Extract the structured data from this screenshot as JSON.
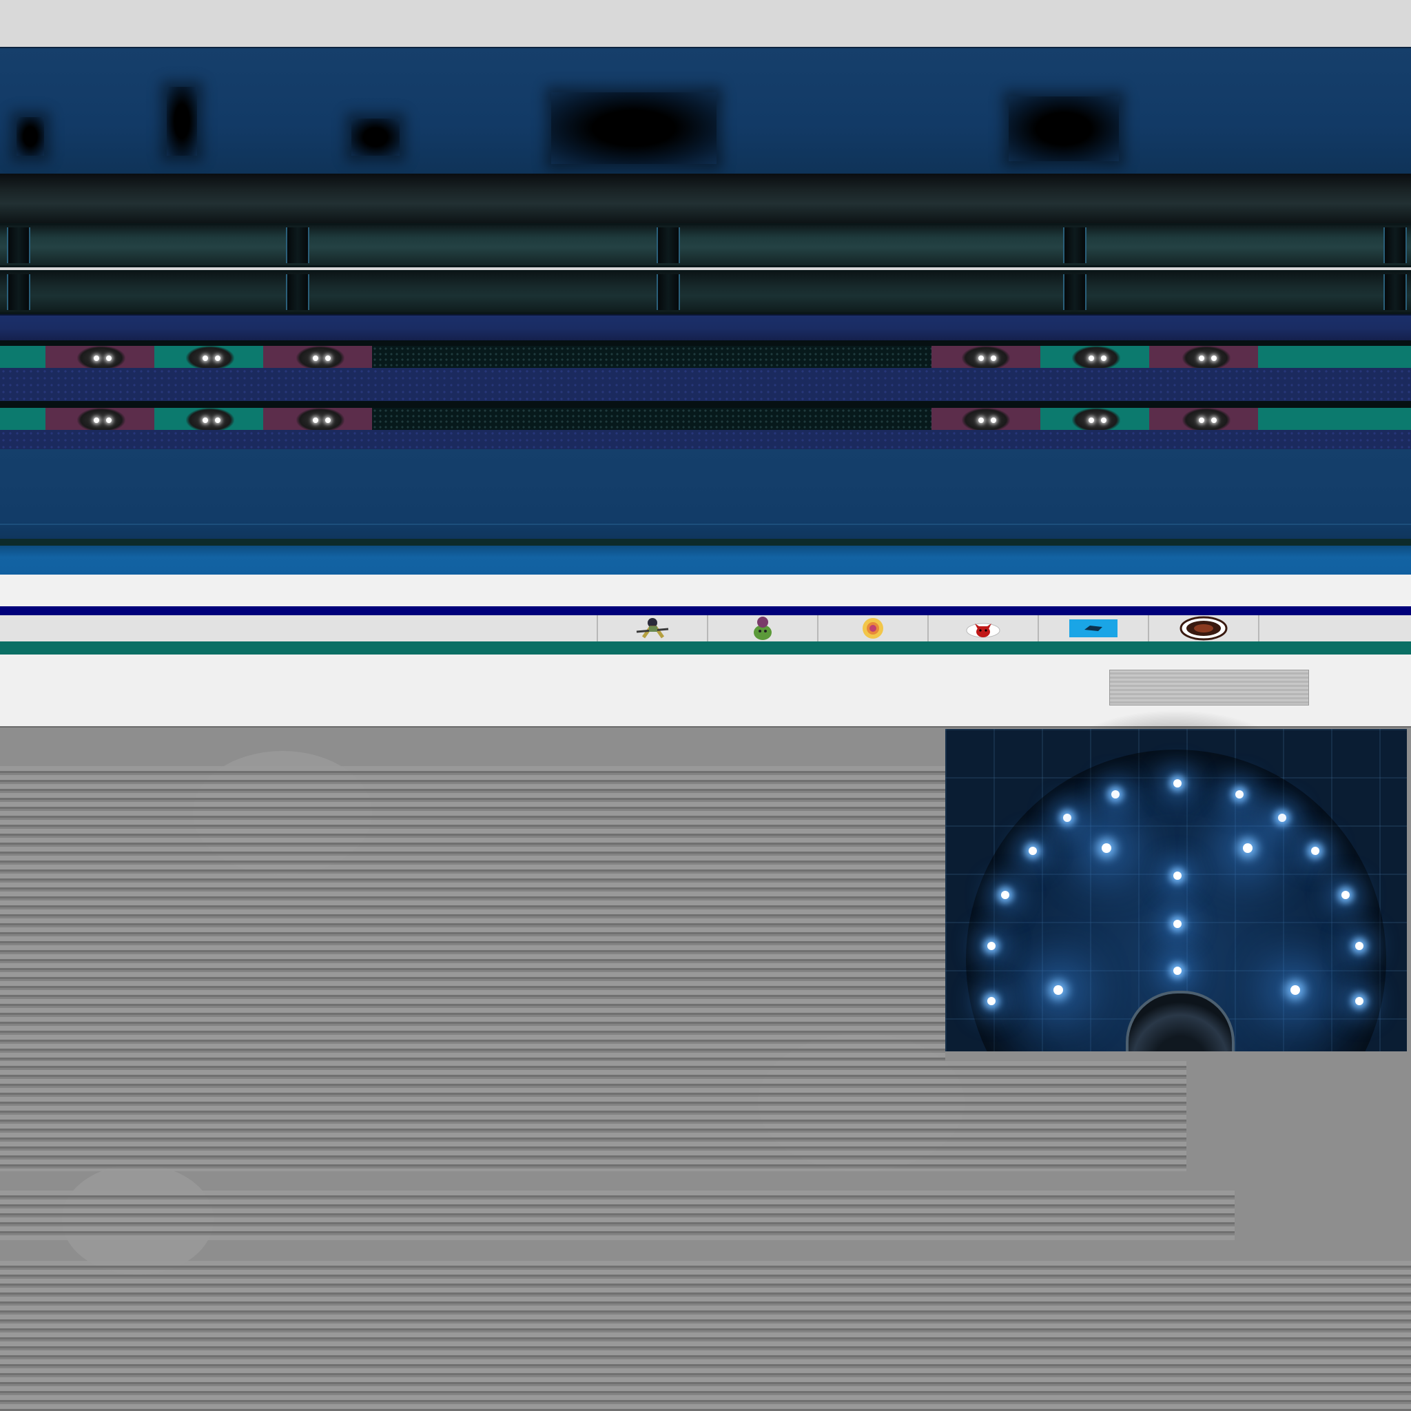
{
  "scene": {
    "name": "arena-texture-atlas",
    "colors": {
      "wall_blue": "#123a66",
      "crowd_teal": "#0c7a6e",
      "crowd_maroon": "#5c2d4b",
      "navy_line": "#00007a",
      "teal_band": "#0a6f64",
      "concrete": "#8e8e8e",
      "dome_light": "#78beff"
    }
  },
  "sponsors": {
    "count": 6,
    "icons": [
      "runner-mascot-icon",
      "green-mascot-icon",
      "sun-emblem-icon",
      "red-horned-mascot-icon",
      "blue-banner-icon",
      "round-badge-icon"
    ]
  }
}
